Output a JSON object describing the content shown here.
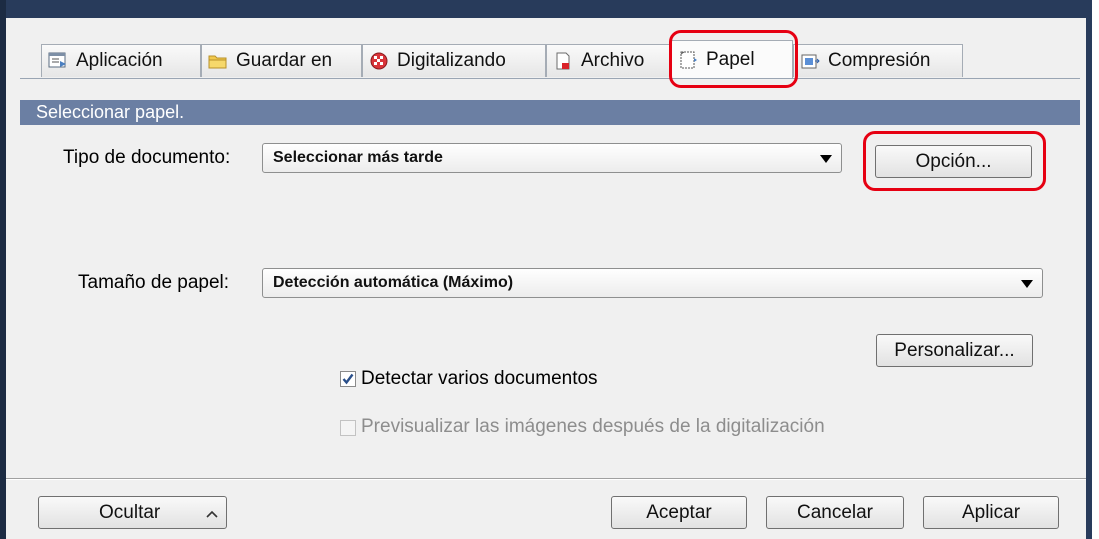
{
  "tabs": [
    {
      "label": "Aplicación",
      "icon": "application-icon"
    },
    {
      "label": "Guardar en",
      "icon": "folder-icon"
    },
    {
      "label": "Digitalizando",
      "icon": "scan-icon"
    },
    {
      "label": "Archivo",
      "icon": "file-icon"
    },
    {
      "label": "Papel",
      "icon": "paper-icon",
      "active": true
    },
    {
      "label": "Compresión",
      "icon": "compression-icon"
    }
  ],
  "section": {
    "title": "Seleccionar papel."
  },
  "document_type": {
    "label": "Tipo de documento:",
    "value": "Seleccionar más tarde",
    "option_button": "Opción..."
  },
  "paper_size": {
    "label": "Tamaño de papel:",
    "value": "Detección automática (Máximo)",
    "customize_button": "Personalizar..."
  },
  "options": {
    "detect_multiple": {
      "label": "Detectar varios documentos",
      "checked": true
    },
    "preview_images": {
      "label": "Previsualizar las imágenes después de la digitalización",
      "checked": false,
      "disabled": true
    }
  },
  "footer": {
    "hide_button": "Ocultar",
    "accept_button": "Aceptar",
    "cancel_button": "Cancelar",
    "apply_button": "Aplicar"
  },
  "colors": {
    "highlight": "#e60012",
    "section_header": "#6b7fa3",
    "title_strip": "#283b5b"
  }
}
